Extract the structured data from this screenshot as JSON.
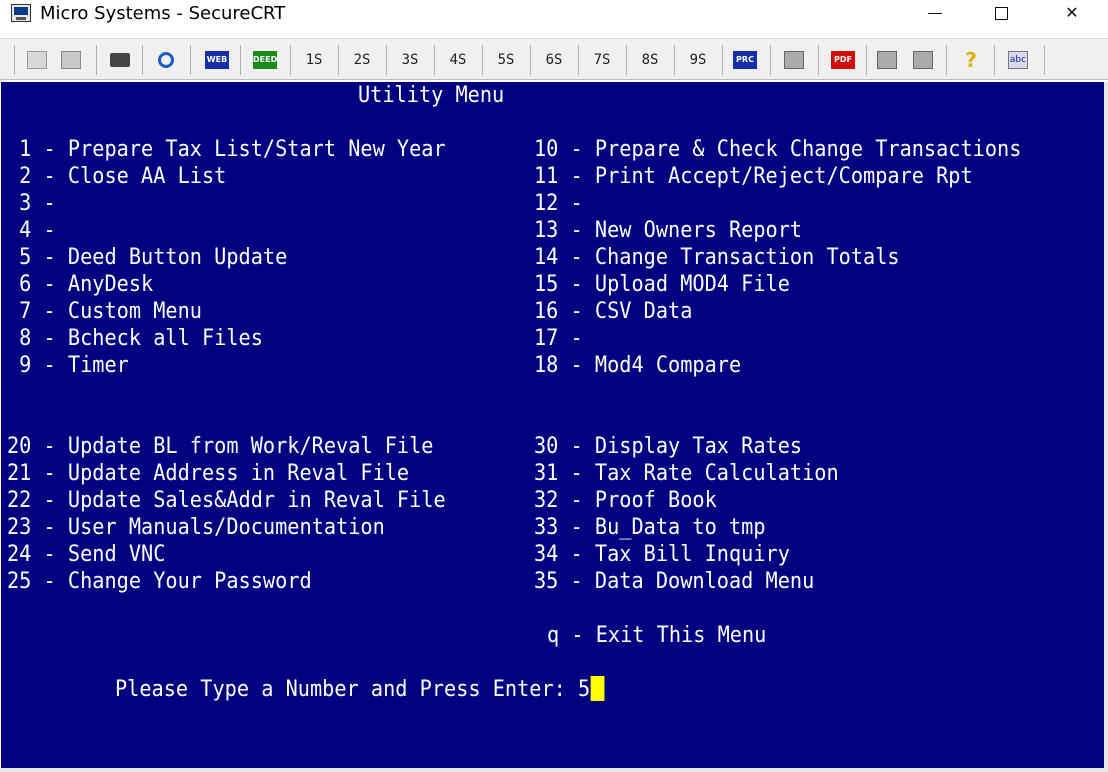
{
  "window": {
    "title": "Micro Systems - SecureCRT"
  },
  "toolbar": {
    "session_buttons": [
      "1S",
      "2S",
      "3S",
      "4S",
      "5S",
      "6S",
      "7S",
      "8S",
      "9S"
    ],
    "icons": [
      "copy-icon",
      "paste-icon",
      "print-icon",
      "find-icon",
      "web-icon",
      "deed-icon",
      "prc-icon",
      "session-options-icon",
      "pdf-icon",
      "properties-icon",
      "global-options-icon",
      "help-icon",
      "spell-check-icon"
    ],
    "web_label": "WEB",
    "deed_label": "DEED",
    "prc_label": "PRC",
    "pdf_label": "PDF",
    "abc_label": "abc"
  },
  "colors": {
    "terminal_bg": "#000080",
    "terminal_fg": "#ffffff",
    "cursor": "#ffff00"
  },
  "terminal": {
    "title": "Utility Menu",
    "left_items": [
      " 1 - Prepare Tax List/Start New Year",
      " 2 - Close AA List",
      " 3 -",
      " 4 -",
      " 5 - Deed Button Update",
      " 6 - AnyDesk",
      " 7 - Custom Menu",
      " 8 - Bcheck all Files",
      " 9 - Timer"
    ],
    "right_items": [
      "10 - Prepare & Check Change Transactions",
      "11 - Print Accept/Reject/Compare Rpt",
      "12 -",
      "13 - New Owners Report",
      "14 - Change Transaction Totals",
      "15 - Upload MOD4 File",
      "16 - CSV Data",
      "17 -",
      "18 - Mod4 Compare"
    ],
    "left_items_2": [
      "20 - Update BL from Work/Reval File",
      "21 - Update Address in Reval File",
      "22 - Update Sales&Addr in Reval File",
      "23 - User Manuals/Documentation",
      "24 - Send VNC",
      "25 - Change Your Password"
    ],
    "right_items_2": [
      "30 - Display Tax Rates",
      "31 - Tax Rate Calculation",
      "32 - Proof Book",
      "33 - Bu_Data to tmp",
      "34 - Tax Bill Inquiry",
      "35 - Data Download Menu"
    ],
    "exit_item": "q - Exit This Menu",
    "prompt": "Please Type a Number and Press Enter: ",
    "input_value": "5"
  }
}
